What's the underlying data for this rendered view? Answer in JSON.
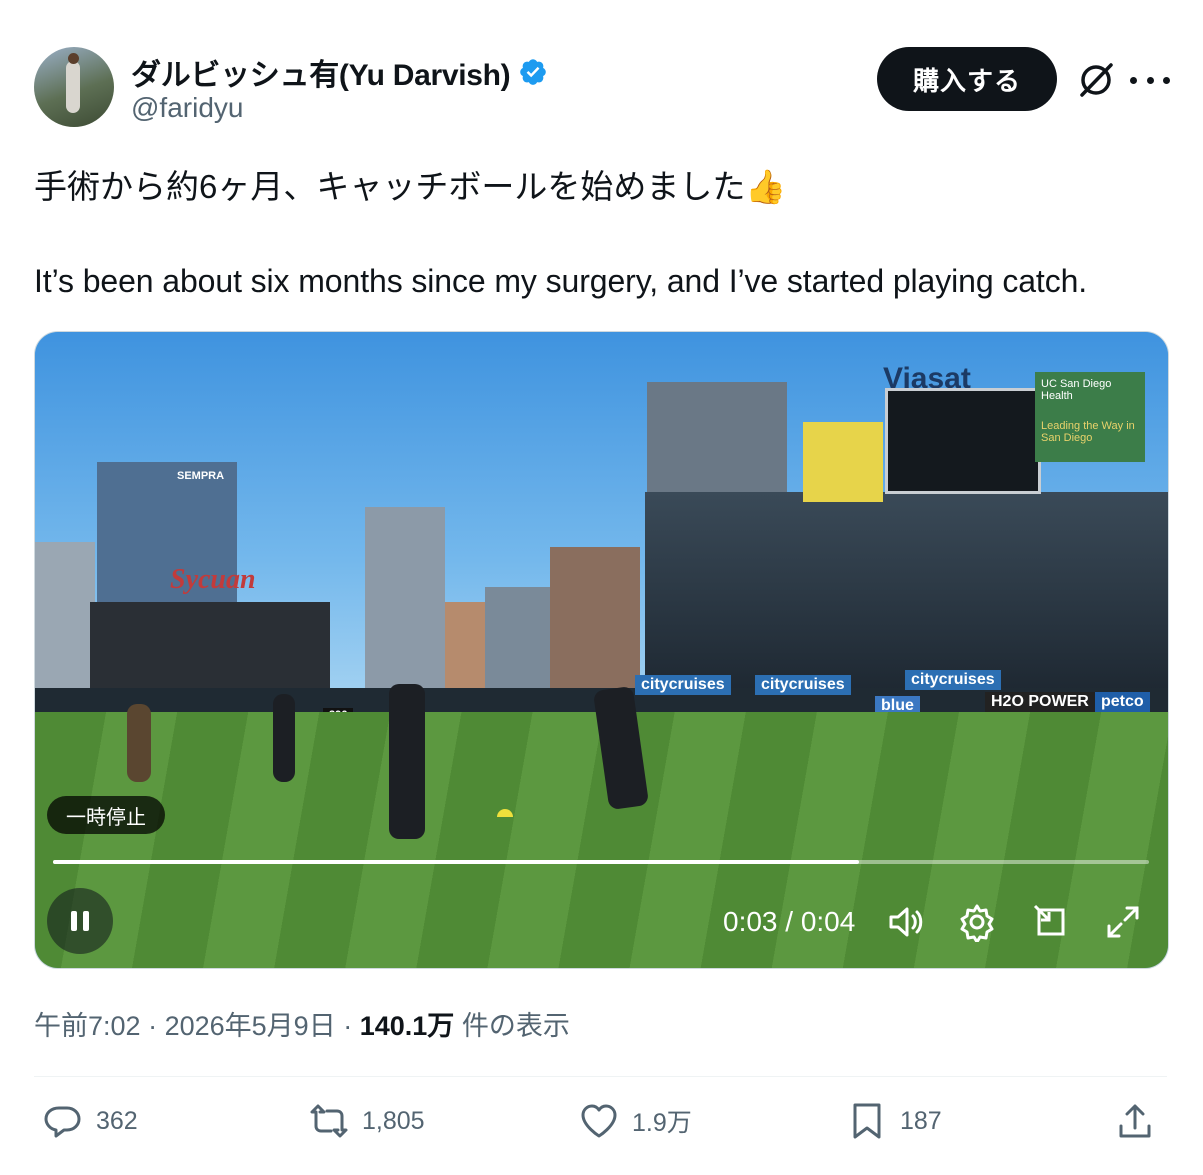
{
  "author": {
    "display_name": "ダルビッシュ有(Yu Darvish)",
    "handle": "@faridyu",
    "verified_icon": "verified-badge-icon"
  },
  "header": {
    "buy_label": "購入する"
  },
  "tweet": {
    "text_ja": "手術から約6ヶ月、キャッチボールを始めました👍",
    "text_en": "It’s been about six months since my surgery, and I’ve started playing catch."
  },
  "video": {
    "pause_tooltip": "一時停止",
    "time_display": "0:03 / 0:04",
    "progress_fraction": 0.735,
    "signage": {
      "viasat": "Viasat",
      "sempra": "SEMPRA",
      "sycuan": "Sycuan",
      "ucsd_health": "UC San Diego Health",
      "leading": "Leading the Way in San Diego",
      "citycruises": "citycruises",
      "blue": "blue",
      "h2o": "H2O POWER",
      "petco": "petco",
      "number_396": "396"
    }
  },
  "meta": {
    "time": "午前7:02",
    "date": "2026年5月9日",
    "views_count": "140.1万",
    "views_label": "件の表示",
    "separator": "·"
  },
  "actions": {
    "replies": "362",
    "reposts": "1,805",
    "likes": "1.9万",
    "bookmarks": "187"
  },
  "colors": {
    "text": "#0f1419",
    "secondary": "#536471",
    "verified": "#1d9bf0",
    "button_bg": "#0f1419"
  }
}
